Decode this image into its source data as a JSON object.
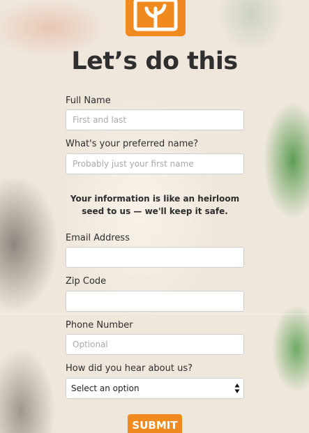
{
  "heading": "Let’s do this",
  "fields": {
    "full_name": {
      "label": "Full Name",
      "placeholder": "First and last",
      "value": ""
    },
    "preferred_name": {
      "label": "What's your preferred name?",
      "placeholder": "Probably just your first name",
      "value": ""
    },
    "email": {
      "label": "Email Address",
      "placeholder": "",
      "value": ""
    },
    "zip": {
      "label": "Zip Code",
      "placeholder": "",
      "value": ""
    },
    "phone": {
      "label": "Phone Number",
      "placeholder": "Optional",
      "value": ""
    },
    "referral": {
      "label": "How did you hear about us?",
      "selected": "Select an option"
    }
  },
  "notice": "Your information is like an heirloom seed to us — we'll keep it safe.",
  "submit_label": "SUBMIT",
  "footer_fragment": "",
  "colors": {
    "accent": "#f08a1f",
    "text": "#2f2f2f"
  },
  "icons": {
    "logo": "seedling-logo-icon",
    "select_arrows": "up-down-arrows-icon"
  }
}
